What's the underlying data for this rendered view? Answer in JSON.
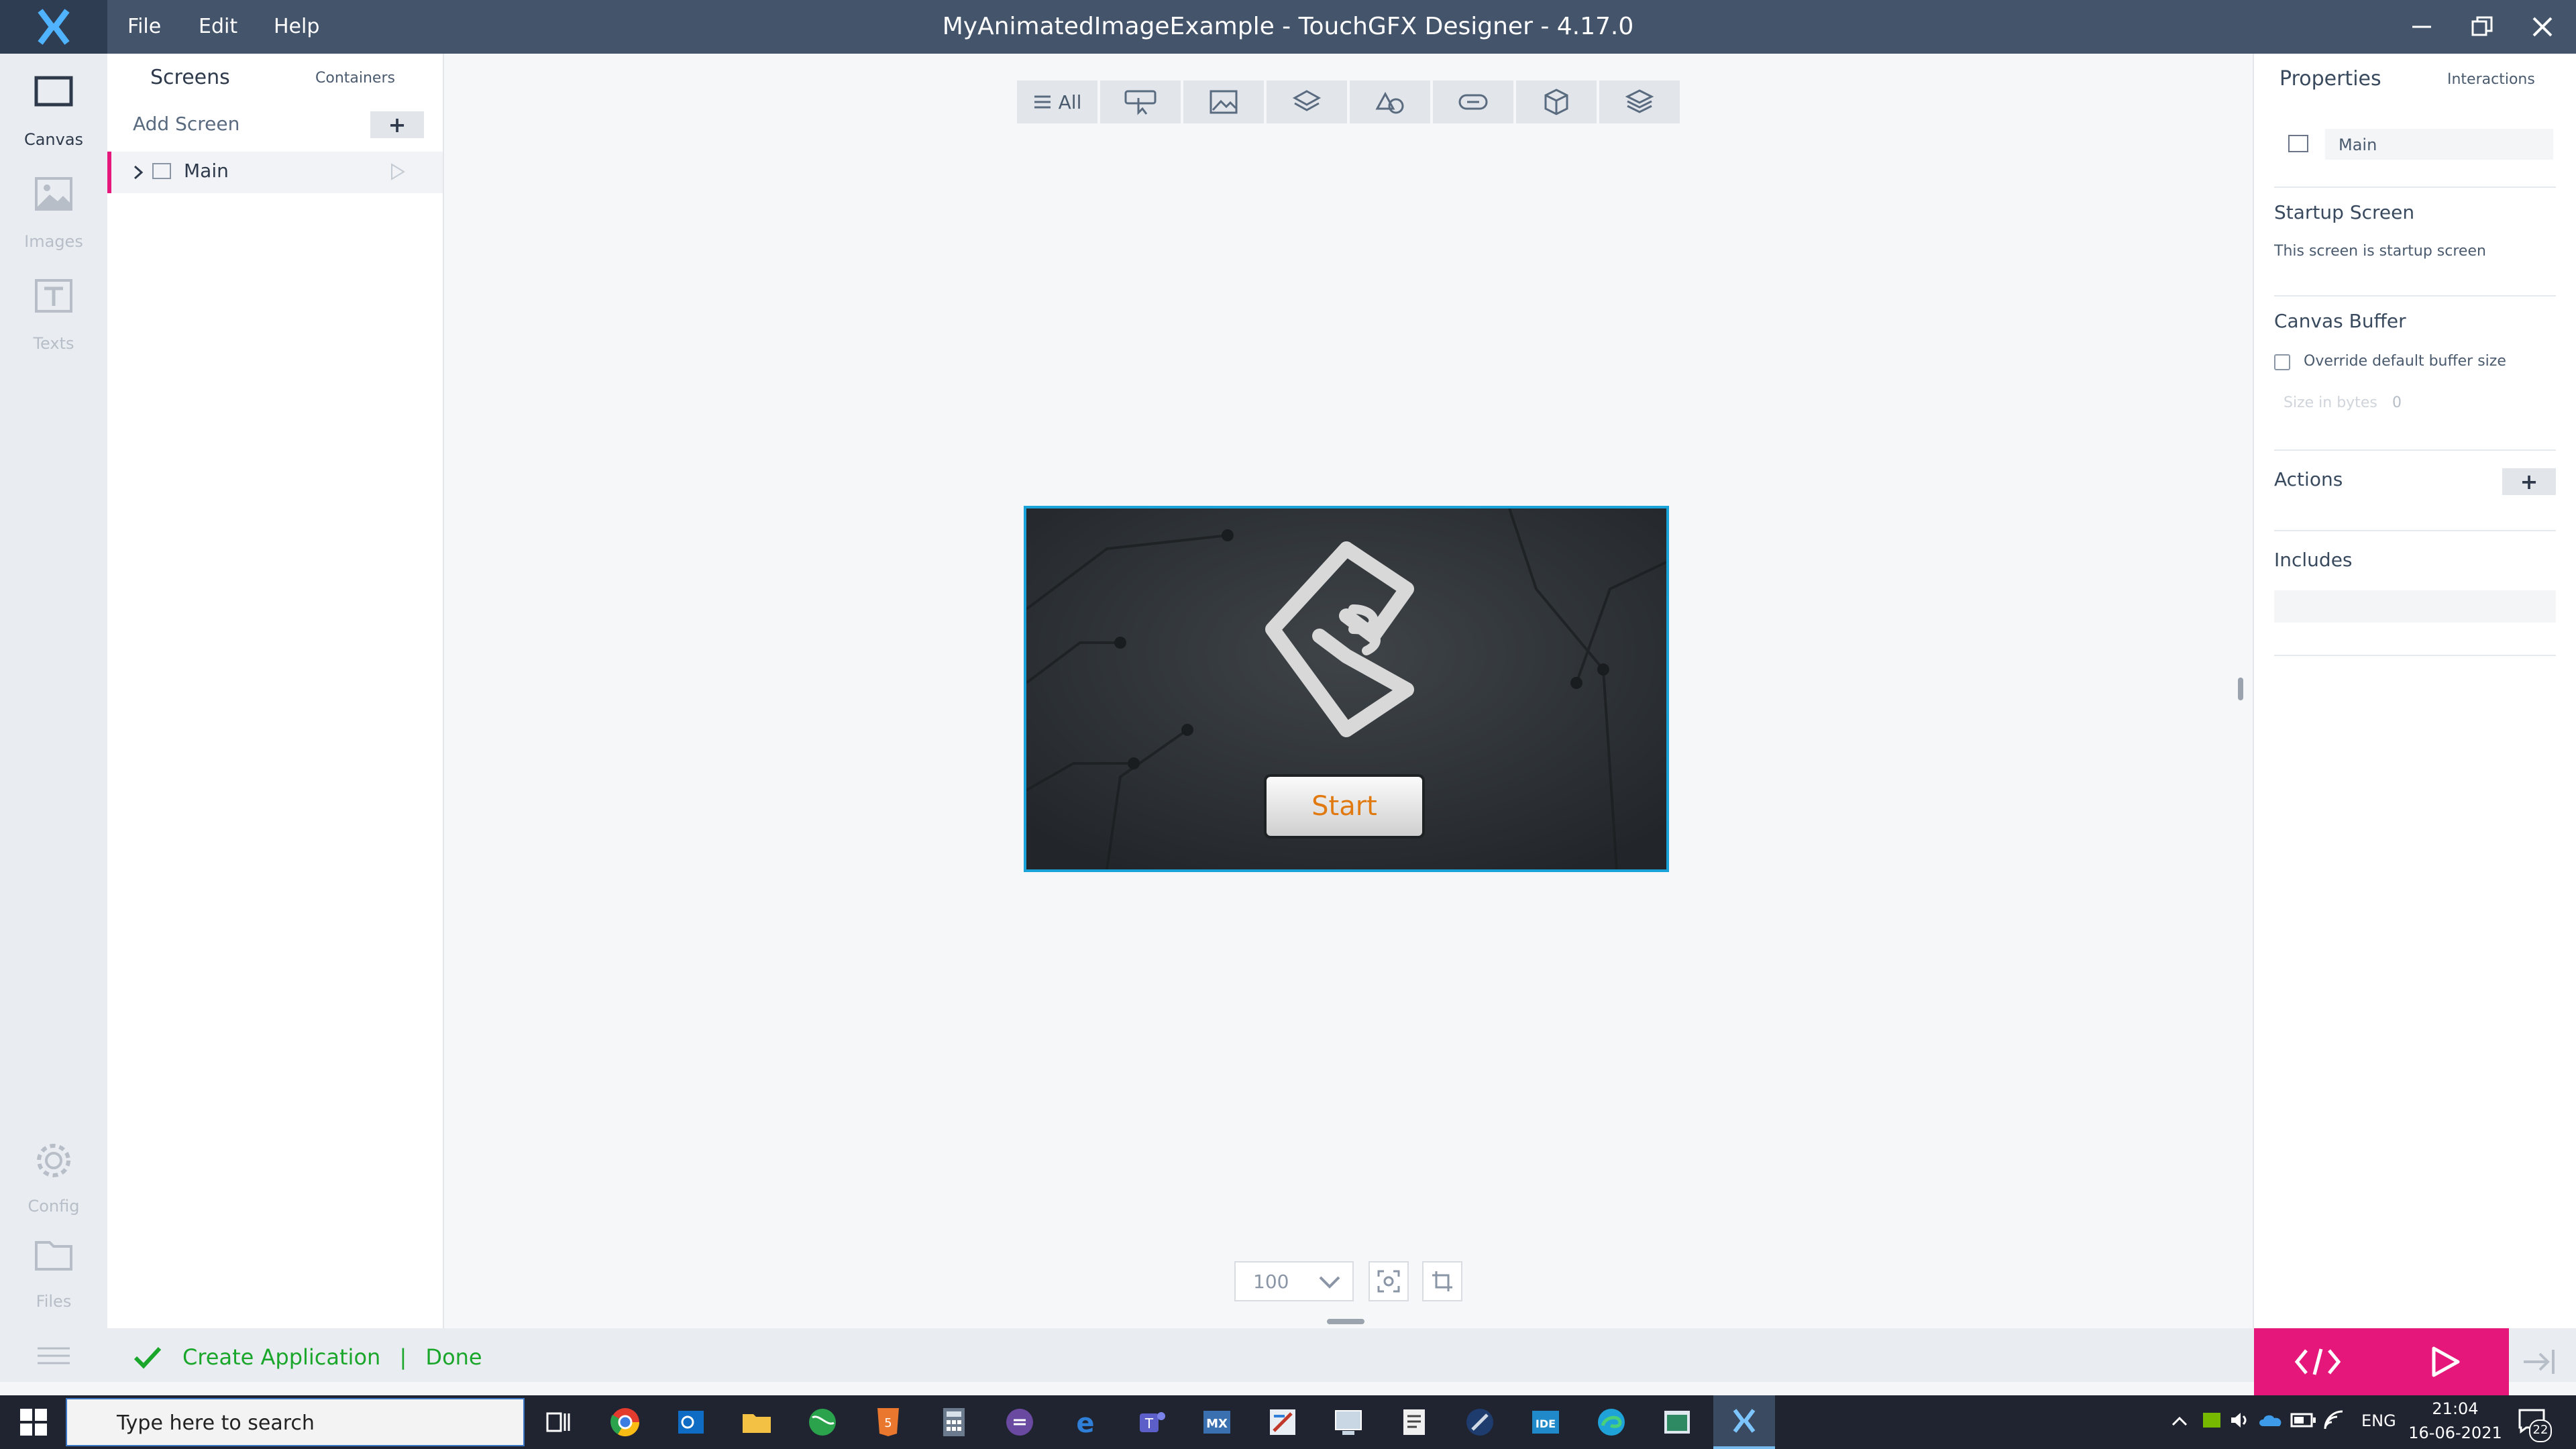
{
  "window": {
    "title": "MyAnimatedImageExample - TouchGFX Designer - 4.17.0",
    "menu": [
      "File",
      "Edit",
      "Help"
    ]
  },
  "leftnav": {
    "items": [
      {
        "label": "Canvas",
        "icon": "canvas-icon",
        "active": true
      },
      {
        "label": "Images",
        "icon": "image-icon",
        "active": false
      },
      {
        "label": "Texts",
        "icon": "text-icon",
        "active": false
      },
      {
        "label": "Config",
        "icon": "gear-icon",
        "active": false
      },
      {
        "label": "Files",
        "icon": "folder-icon",
        "active": false
      }
    ]
  },
  "screens_panel": {
    "tab_screens": "Screens",
    "tab_containers": "Containers",
    "add_screen": "Add Screen",
    "add_symbol": "+",
    "items": [
      {
        "name": "Main"
      }
    ]
  },
  "toolbar": {
    "all_label": "All",
    "icons": [
      "all-icon",
      "interaction-icon",
      "image-icon",
      "layers-icon",
      "shapes-icon",
      "button-icon",
      "3d-box-icon",
      "stack-icon"
    ]
  },
  "canvas": {
    "button_label": "Start",
    "zoom_value": "100"
  },
  "properties": {
    "tab_properties": "Properties",
    "tab_interactions": "Interactions",
    "screen_name": "Main",
    "startup_title": "Startup Screen",
    "startup_text": "This screen is startup screen",
    "canvas_buffer_title": "Canvas Buffer",
    "override_label": "Override default buffer size",
    "size_label": "Size in bytes",
    "size_value": "0",
    "actions_title": "Actions",
    "actions_add": "+",
    "includes_title": "Includes"
  },
  "status": {
    "message": "Create Application",
    "separator": "|",
    "state": "Done",
    "color": "#1aa62b"
  },
  "accent": {
    "pink": "#e6177a",
    "selection": "#19a3d8"
  },
  "taskbar": {
    "search_placeholder": "Type here to search",
    "time": "21:04",
    "date": "16-06-2021",
    "lang": "ENG",
    "notifications": "22",
    "apps": [
      "chrome-icon",
      "outlook-icon",
      "explorer-icon",
      "browser-icon",
      "html-icon",
      "calculator-icon",
      "eclipse-icon",
      "edge-legacy-icon",
      "teams-icon",
      "cubemx-icon",
      "paint-icon",
      "remote-icon",
      "notes-icon",
      "tool-icon",
      "ide-icon",
      "edge-icon",
      "monitor-icon",
      "touchgfx-icon"
    ]
  }
}
